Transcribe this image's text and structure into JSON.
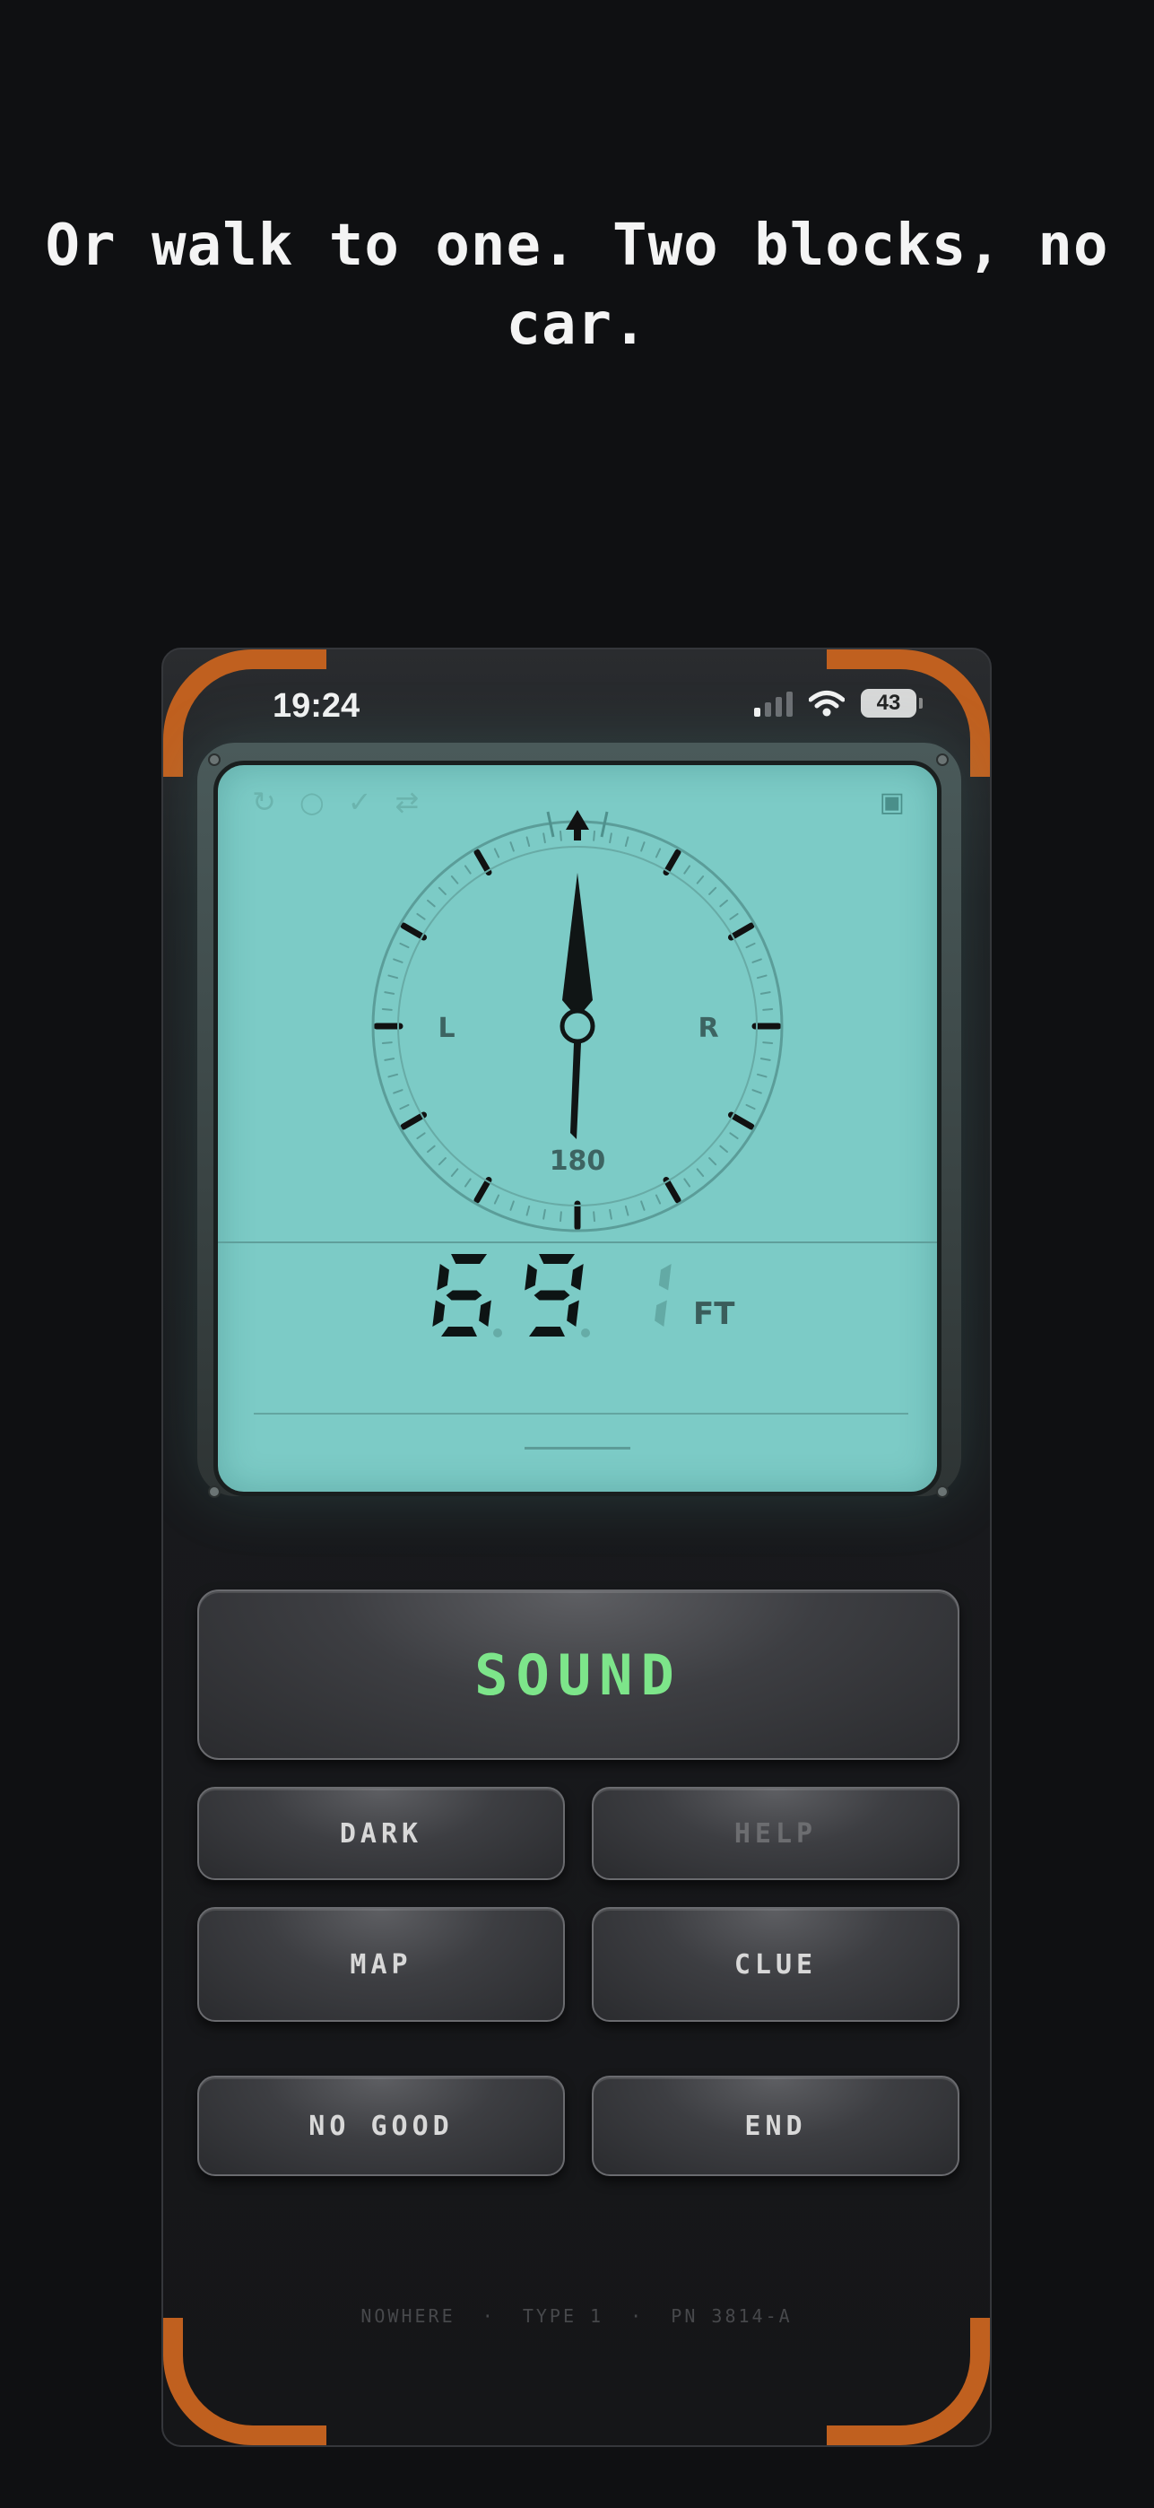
{
  "headline": "Or walk to one. Two blocks, no car.",
  "status_bar": {
    "time": "19:24",
    "battery": "43",
    "signal_bars_active": 1,
    "signal_bars_total": 4
  },
  "lcd": {
    "top_icons": [
      "↻",
      "○",
      "✓",
      "⇄"
    ],
    "corner_icon": "▣",
    "compass": {
      "left_label": "L",
      "right_label": "R",
      "bottom_label": "180",
      "needle_heading_deg": 0
    },
    "distance": {
      "digits": [
        "6",
        "9",
        "1"
      ],
      "unit": "FT"
    }
  },
  "buttons": {
    "sound": "SOUND",
    "dark": "DARK",
    "help": "HELP",
    "map": "MAP",
    "clue": "CLUE",
    "no_good": "NO GOOD",
    "end": "END"
  },
  "footer": "NOWHERE  ·  TYPE 1  ·  PN 3814-A",
  "colors": {
    "accent": "#c0601f",
    "lcd_bg": "#7ccbc6",
    "sound_text": "#7de58a",
    "background": "#0f1012"
  }
}
